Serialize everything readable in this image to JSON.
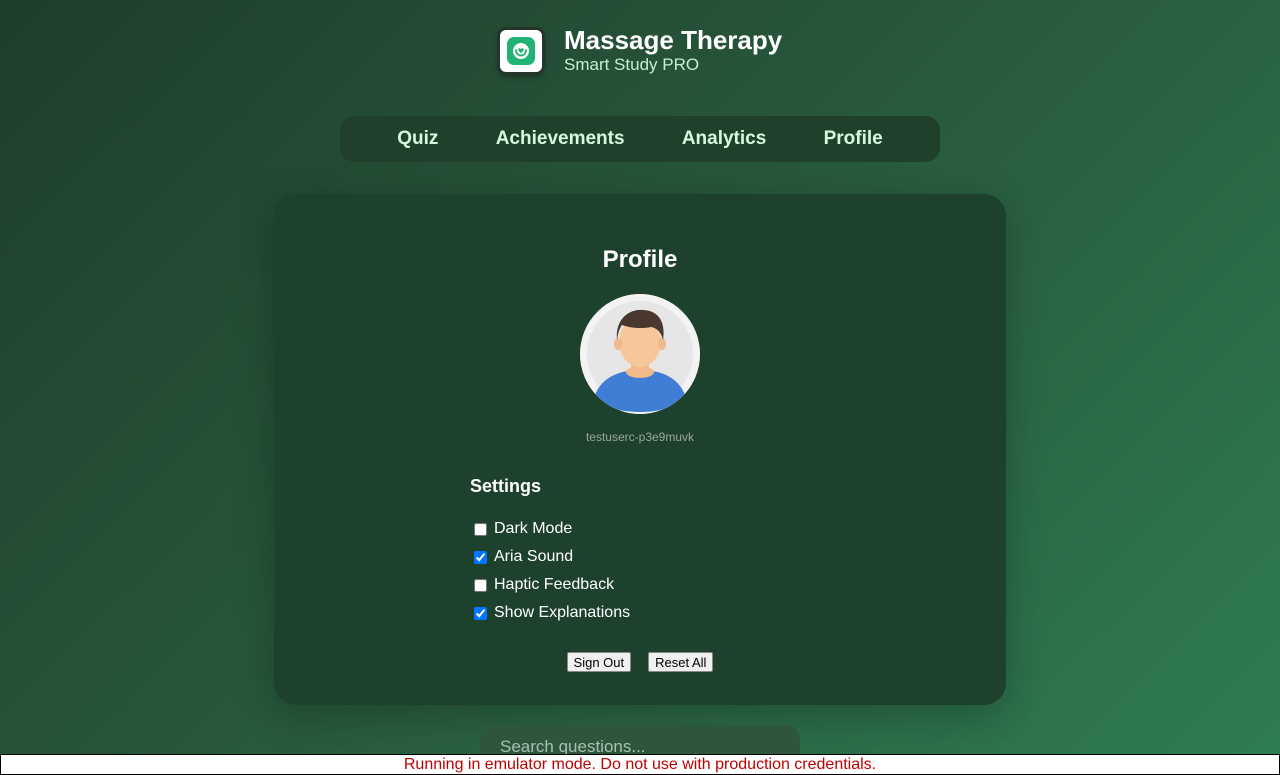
{
  "app": {
    "title": "Massage Therapy",
    "subtitle": "Smart Study PRO",
    "icon": "hands-heart-icon",
    "accent_color": "#22b374"
  },
  "nav": {
    "items": [
      {
        "label": "Quiz"
      },
      {
        "label": "Achievements"
      },
      {
        "label": "Analytics"
      },
      {
        "label": "Profile"
      }
    ]
  },
  "profile": {
    "title": "Profile",
    "avatar_icon": "user-avatar-icon",
    "username": "testuserc-p3e9muvk",
    "settings": {
      "title": "Settings",
      "options": [
        {
          "label": "Dark Mode",
          "checked": false
        },
        {
          "label": "Aria Sound",
          "checked": true
        },
        {
          "label": "Haptic Feedback",
          "checked": false
        },
        {
          "label": "Show Explanations",
          "checked": true
        }
      ]
    },
    "buttons": {
      "sign_out": "Sign Out",
      "reset_all": "Reset All"
    }
  },
  "search": {
    "placeholder": "Search questions..."
  },
  "emulator_banner": "Running in emulator mode. Do not use with production credentials."
}
